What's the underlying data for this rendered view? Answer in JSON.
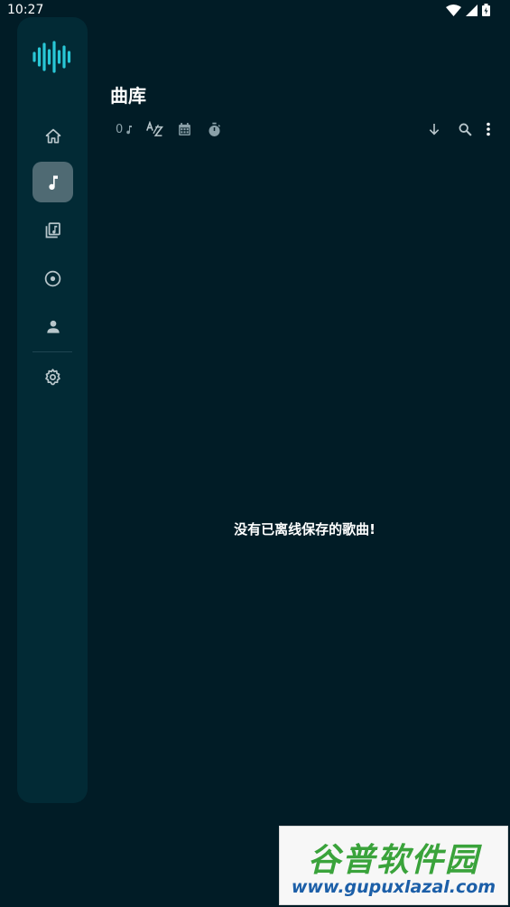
{
  "status_bar": {
    "time": "10:27",
    "icons": [
      "wifi-icon",
      "signal-icon",
      "battery-icon"
    ]
  },
  "nav_rail": {
    "logo": "waveform-logo-icon",
    "items": [
      {
        "id": "home",
        "icon": "home-icon",
        "active": false
      },
      {
        "id": "songs",
        "icon": "music-note-icon",
        "active": true
      },
      {
        "id": "playlists",
        "icon": "playlist-icon",
        "active": false
      },
      {
        "id": "albums",
        "icon": "album-icon",
        "active": false
      },
      {
        "id": "artists",
        "icon": "person-icon",
        "active": false
      },
      {
        "id": "settings",
        "icon": "gear-icon",
        "active": false
      }
    ]
  },
  "page": {
    "title": "曲库",
    "song_count": "0",
    "empty_message": "没有已离线保存的歌曲!"
  },
  "toolbar": {
    "left": [
      "music-note-icon",
      "sort-az-icon",
      "calendar-icon",
      "timer-icon"
    ],
    "right": [
      "arrow-down-icon",
      "search-icon",
      "more-vert-icon"
    ]
  },
  "watermark": {
    "brand": "谷普软件园",
    "url": "www.gupuxlazal.com"
  },
  "colors": {
    "background": "#011c26",
    "rail": "#022a35",
    "active_item": "#4f6a73",
    "accent": "#29c7d6",
    "icon": "#b8c6cb"
  }
}
